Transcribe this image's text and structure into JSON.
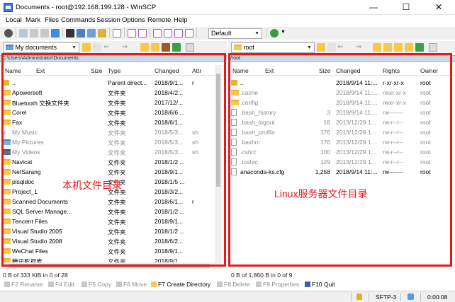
{
  "window": {
    "title": "Documents - root@192.168.199.128 - WinSCP",
    "minimize": "—",
    "maximize": "☐",
    "close": "✕"
  },
  "menu": [
    "Local",
    "Mark",
    "Files",
    "Commands",
    "Session",
    "Options",
    "Remote",
    "Help"
  ],
  "toolbar": {
    "transfer_profile": "Default"
  },
  "left": {
    "location": "My documents",
    "path": "C:\\Users\\Administrator\\Documents",
    "columns": [
      "Name",
      "Ext",
      "Size",
      "Type",
      "Changed",
      "Attr"
    ],
    "rows": [
      {
        "name": "..",
        "size": "",
        "type": "Parent direct...",
        "changed": "2018/9/1...",
        "attr": "r",
        "icon": "parent-dir-icon"
      },
      {
        "name": "Apowersoft",
        "size": "",
        "type": "文件夹",
        "changed": "2018/4/2...",
        "attr": "",
        "icon": "folder-icon"
      },
      {
        "name": "Bluetooth 交换文件夹",
        "size": "",
        "type": "文件夹",
        "changed": "2017/12/...",
        "attr": "",
        "icon": "folder-icon"
      },
      {
        "name": "Corel",
        "size": "",
        "type": "文件夹",
        "changed": "2018/6/6 ...",
        "attr": "",
        "icon": "folder-icon"
      },
      {
        "name": "Fax",
        "size": "",
        "type": "文件夹",
        "changed": "2018/6/1...",
        "attr": "",
        "icon": "folder-icon"
      },
      {
        "name": "My Music",
        "size": "",
        "type": "文件夹",
        "changed": "2018/5/3...",
        "attr": "sh",
        "icon": "music-folder-icon",
        "dim": true
      },
      {
        "name": "My Pictures",
        "size": "",
        "type": "文件夹",
        "changed": "2018/5/3...",
        "attr": "sh",
        "icon": "pictures-folder-icon",
        "dim": true
      },
      {
        "name": "My Videos",
        "size": "",
        "type": "文件夹",
        "changed": "2018/5/3...",
        "attr": "sh",
        "icon": "videos-folder-icon",
        "dim": true
      },
      {
        "name": "Navicat",
        "size": "",
        "type": "文件夹",
        "changed": "2018/1/2 ...",
        "attr": "",
        "icon": "folder-icon"
      },
      {
        "name": "NetSarang",
        "size": "",
        "type": "文件夹",
        "changed": "2018/9/1...",
        "attr": "",
        "icon": "folder-icon"
      },
      {
        "name": "plsqldoc",
        "size": "",
        "type": "文件夹",
        "changed": "2018/1/5 ...",
        "attr": "",
        "icon": "folder-icon"
      },
      {
        "name": "Project_1",
        "size": "",
        "type": "文件夹",
        "changed": "2018/3/2...",
        "attr": "",
        "icon": "folder-icon"
      },
      {
        "name": "Scanned Documents",
        "size": "",
        "type": "文件夹",
        "changed": "2018/6/1...",
        "attr": "r",
        "icon": "folder-icon"
      },
      {
        "name": "SQL Server Manage...",
        "size": "",
        "type": "文件夹",
        "changed": "2018/1/2 ...",
        "attr": "",
        "icon": "folder-icon"
      },
      {
        "name": "Tencent Files",
        "size": "",
        "type": "文件夹",
        "changed": "2018/9/1...",
        "attr": "",
        "icon": "folder-icon"
      },
      {
        "name": "Visual Studio 2005",
        "size": "",
        "type": "文件夹",
        "changed": "2018/1/2 ...",
        "attr": "",
        "icon": "folder-icon"
      },
      {
        "name": "Visual Studio 2008",
        "size": "",
        "type": "文件夹",
        "changed": "2018/6/2...",
        "attr": "",
        "icon": "folder-icon"
      },
      {
        "name": "WeChat Files",
        "size": "",
        "type": "文件夹",
        "changed": "2018/9/1...",
        "attr": "",
        "icon": "folder-icon"
      },
      {
        "name": "腾讯影视库",
        "size": "",
        "type": "文件夹",
        "changed": "2018/9/1...",
        "attr": "",
        "icon": "folder-icon"
      }
    ],
    "status": "0 B of 333 KiB in 0 of 28",
    "annotation": "本机文件目录"
  },
  "right": {
    "location": "root",
    "path": "/root",
    "columns": [
      "Name",
      "Ext",
      "Size",
      "Changed",
      "Rights",
      "Owner"
    ],
    "rows": [
      {
        "name": "..",
        "size": "",
        "changed": "2018/9/14 11:...",
        "rights": "r-xr-xr-x",
        "owner": "root",
        "icon": "parent-dir-icon"
      },
      {
        "name": ".cache",
        "size": "",
        "changed": "2018/9/14 11:...",
        "rights": "rwxr-xr-x",
        "owner": "root",
        "icon": "folder-icon",
        "dim": true
      },
      {
        "name": ".config",
        "size": "",
        "changed": "2018/9/14 11:...",
        "rights": "rwxr-xr-x",
        "owner": "root",
        "icon": "folder-icon",
        "dim": true
      },
      {
        "name": ".bash_history",
        "size": "3",
        "changed": "2018/9/14 11:...",
        "rights": "rw-------",
        "owner": "root",
        "icon": "file-icon",
        "dim": true
      },
      {
        "name": ".bash_logout",
        "size": "18",
        "changed": "2013/12/29 1...",
        "rights": "rw-r--r--",
        "owner": "root",
        "icon": "file-icon",
        "dim": true
      },
      {
        "name": ".bash_profile",
        "size": "176",
        "changed": "2013/12/29 1...",
        "rights": "rw-r--r--",
        "owner": "root",
        "icon": "file-icon",
        "dim": true
      },
      {
        "name": ".bashrc",
        "size": "176",
        "changed": "2013/12/29 1...",
        "rights": "rw-r--r--",
        "owner": "root",
        "icon": "file-icon",
        "dim": true
      },
      {
        "name": ".cshrc",
        "size": "100",
        "changed": "2013/12/29 1...",
        "rights": "rw-r--r--",
        "owner": "root",
        "icon": "file-icon",
        "dim": true
      },
      {
        "name": ".tcshrc",
        "size": "129",
        "changed": "2013/12/29 1...",
        "rights": "rw-r--r--",
        "owner": "root",
        "icon": "file-icon",
        "dim": true
      },
      {
        "name": "anaconda-ks.cfg",
        "size": "1,258",
        "changed": "2018/9/14 11:...",
        "rights": "rw-------",
        "owner": "root",
        "icon": "file-icon"
      }
    ],
    "status": "0 B of 1,860 B in 0 of 9",
    "annotation": "Linux服务器文件目录"
  },
  "fkeys": [
    {
      "label": "F2 Rename",
      "enabled": false,
      "icon": "rename-icon"
    },
    {
      "label": "F4 Edit",
      "enabled": false,
      "icon": "edit-icon"
    },
    {
      "label": "F5 Copy",
      "enabled": false,
      "icon": "copy-icon"
    },
    {
      "label": "F6 Move",
      "enabled": false,
      "icon": "move-icon"
    },
    {
      "label": "F7 Create Directory",
      "enabled": true,
      "icon": "create-directory-icon"
    },
    {
      "label": "F8 Delete",
      "enabled": false,
      "icon": "delete-icon"
    },
    {
      "label": "F9 Properties",
      "enabled": false,
      "icon": "properties-icon"
    },
    {
      "label": "F10 Quit",
      "enabled": true,
      "icon": "quit-icon"
    }
  ],
  "statusbar": {
    "protocol": "SFTP-3",
    "elapsed": "0:00:08"
  },
  "colors": {
    "annotation": "#e81818",
    "folder": "#f6c94a",
    "path_bar": "#cfd9e6"
  }
}
